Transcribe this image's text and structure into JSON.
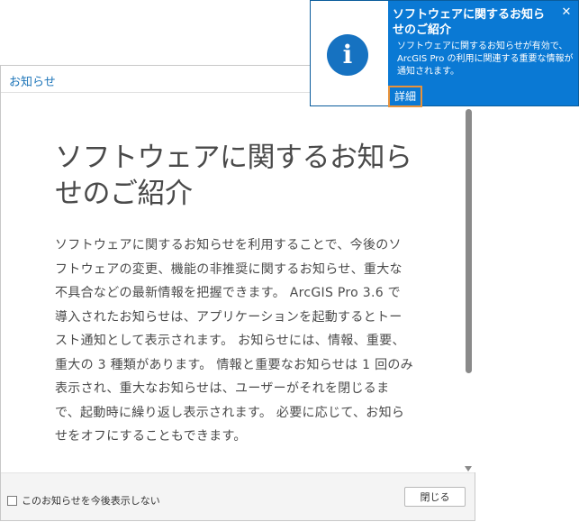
{
  "pane": {
    "title": "お知らせ",
    "heading": "ソフトウェアに関するお知らせのご紹介",
    "body": "ソフトウェアに関するお知らせを利用することで、今後のソフトウェアの変更、機能の非推奨に関するお知らせ、重大な不具合などの最新情報を把握できます。 ArcGIS Pro 3.6 で導入されたお知らせは、アプリケーションを起動するとトースト通知として表示されます。 お知らせには、情報、重要、重大の 3 種類があります。 情報と重要なお知らせは 1 回のみ表示され、重大なお知らせは、ユーザーがそれを閉じるまで、起動時に繰り返し表示されます。 必要に応じて、お知らせをオフにすることもできます。",
    "dont_show_label": "このお知らせを今後表示しない",
    "dont_show_checked": false,
    "close_label": "閉じる"
  },
  "toast": {
    "icon": "info-icon",
    "icon_glyph": "i",
    "title": "ソフトウェアに関するお知らせのご紹介",
    "message": "ソフトウェアに関するお知らせが有効で、ArcGIS Pro の利用に関連する重要な情報が通知されます。",
    "details_label": "詳細",
    "close_glyph": "✕"
  },
  "colors": {
    "accent": "#0a79d4",
    "icon_blue": "#1672c1",
    "focus_outline": "#e8923a",
    "link": "#1a73b8"
  }
}
